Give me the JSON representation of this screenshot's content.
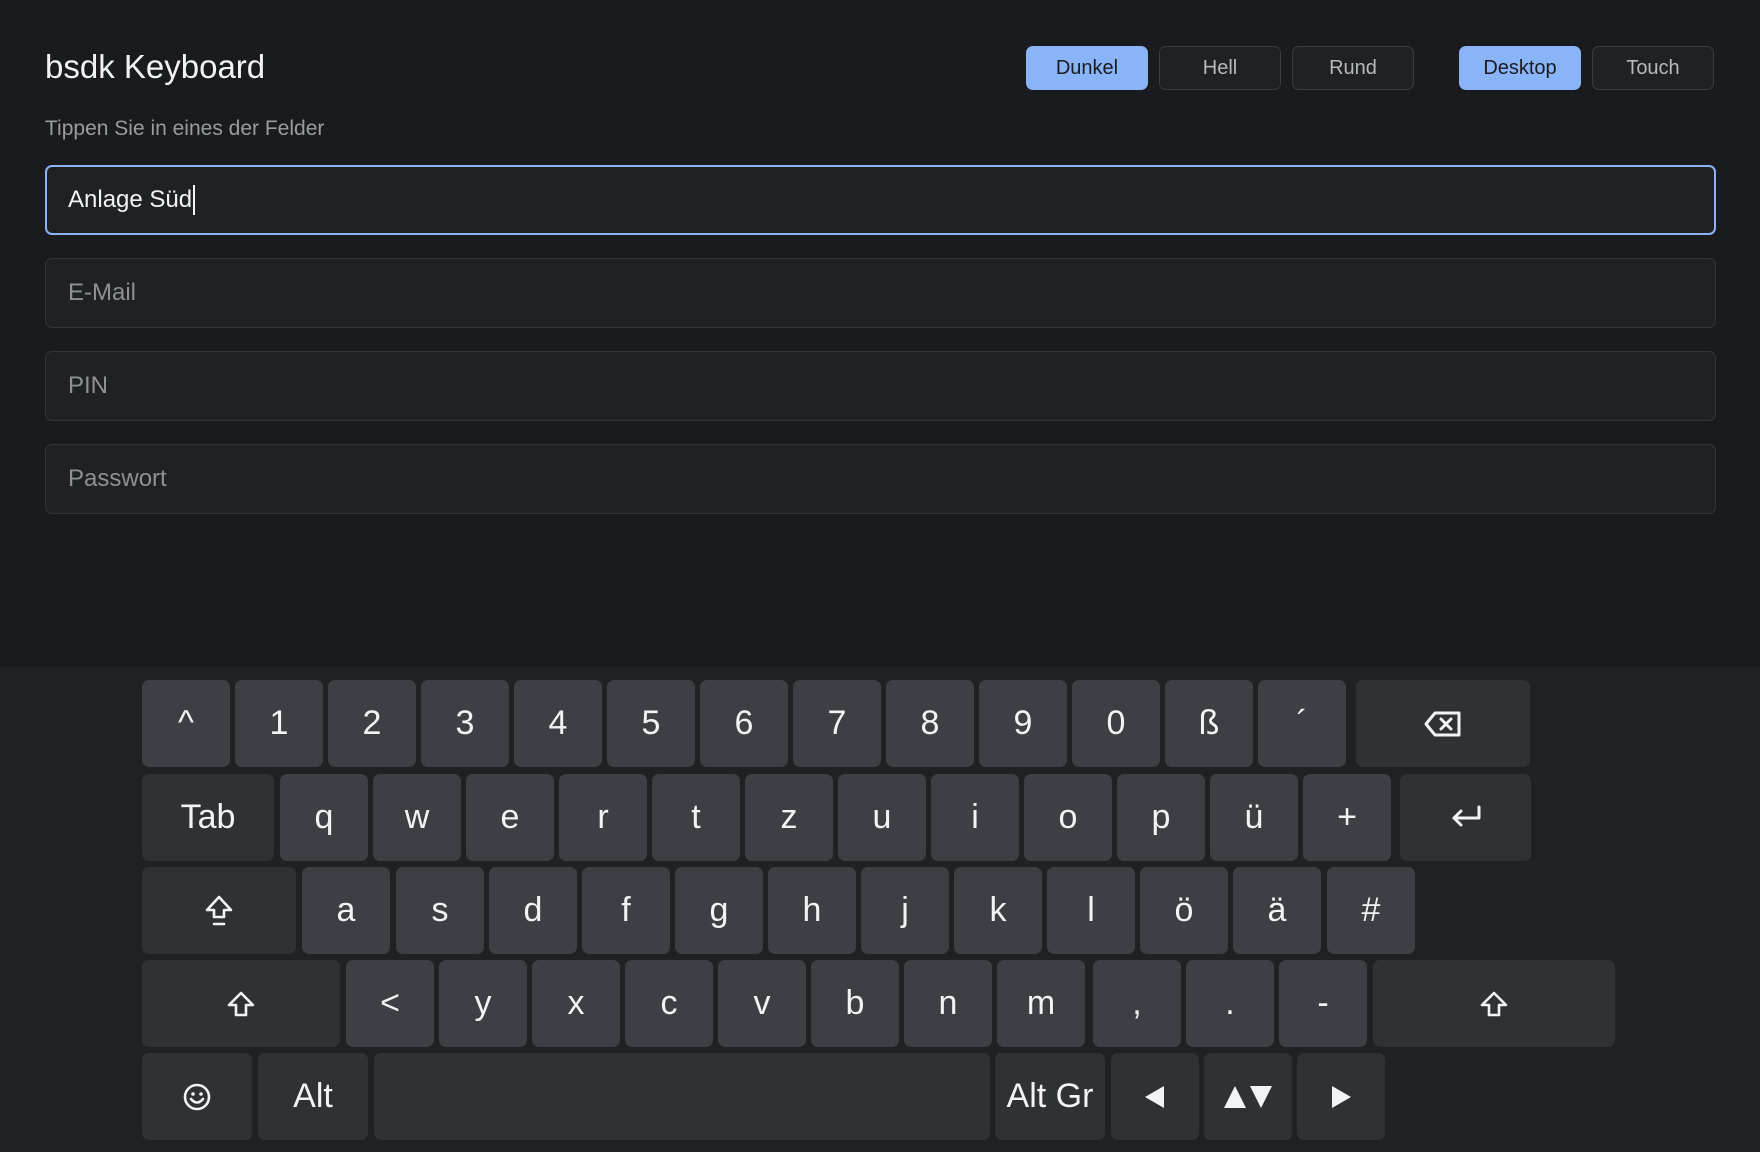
{
  "header": {
    "title": "bsdk Keyboard",
    "subtitle": "Tippen Sie in eines der Felder"
  },
  "theme_buttons": [
    {
      "label": "Dunkel",
      "active": true
    },
    {
      "label": "Hell",
      "active": false
    },
    {
      "label": "Rund",
      "active": false
    }
  ],
  "mode_buttons": [
    {
      "label": "Desktop",
      "active": true
    },
    {
      "label": "Touch",
      "active": false
    }
  ],
  "fields": {
    "name": {
      "value": "Anlage Süd"
    },
    "email": {
      "placeholder": "E-Mail"
    },
    "pin": {
      "placeholder": "PIN"
    },
    "password": {
      "placeholder": "Passwort"
    }
  },
  "keyboard": {
    "row1": [
      "^",
      "1",
      "2",
      "3",
      "4",
      "5",
      "6",
      "7",
      "8",
      "9",
      "0",
      "ß",
      "´"
    ],
    "row2": [
      "q",
      "w",
      "e",
      "r",
      "t",
      "z",
      "u",
      "i",
      "o",
      "p",
      "ü",
      "+"
    ],
    "row3": [
      "a",
      "s",
      "d",
      "f",
      "g",
      "h",
      "j",
      "k",
      "l",
      "ö",
      "ä",
      "#"
    ],
    "row4": [
      "<",
      "y",
      "x",
      "c",
      "v",
      "b",
      "n",
      "m",
      ",",
      ".",
      "-"
    ],
    "tab_label": "Tab",
    "alt_label": "Alt",
    "altgr_label": "Alt Gr",
    "icons": {
      "backspace": "backspace-icon",
      "enter": "enter-icon",
      "capslock": "caps-lock-icon",
      "shift": "shift-icon",
      "emoji": "emoji-icon",
      "left": "arrow-left-icon",
      "updown": "arrow-up-down-icon",
      "right": "arrow-right-icon"
    },
    "colors": {
      "key": "#3c3f43",
      "function_key": "#2f3134",
      "accent": "#8ab4f8"
    }
  }
}
